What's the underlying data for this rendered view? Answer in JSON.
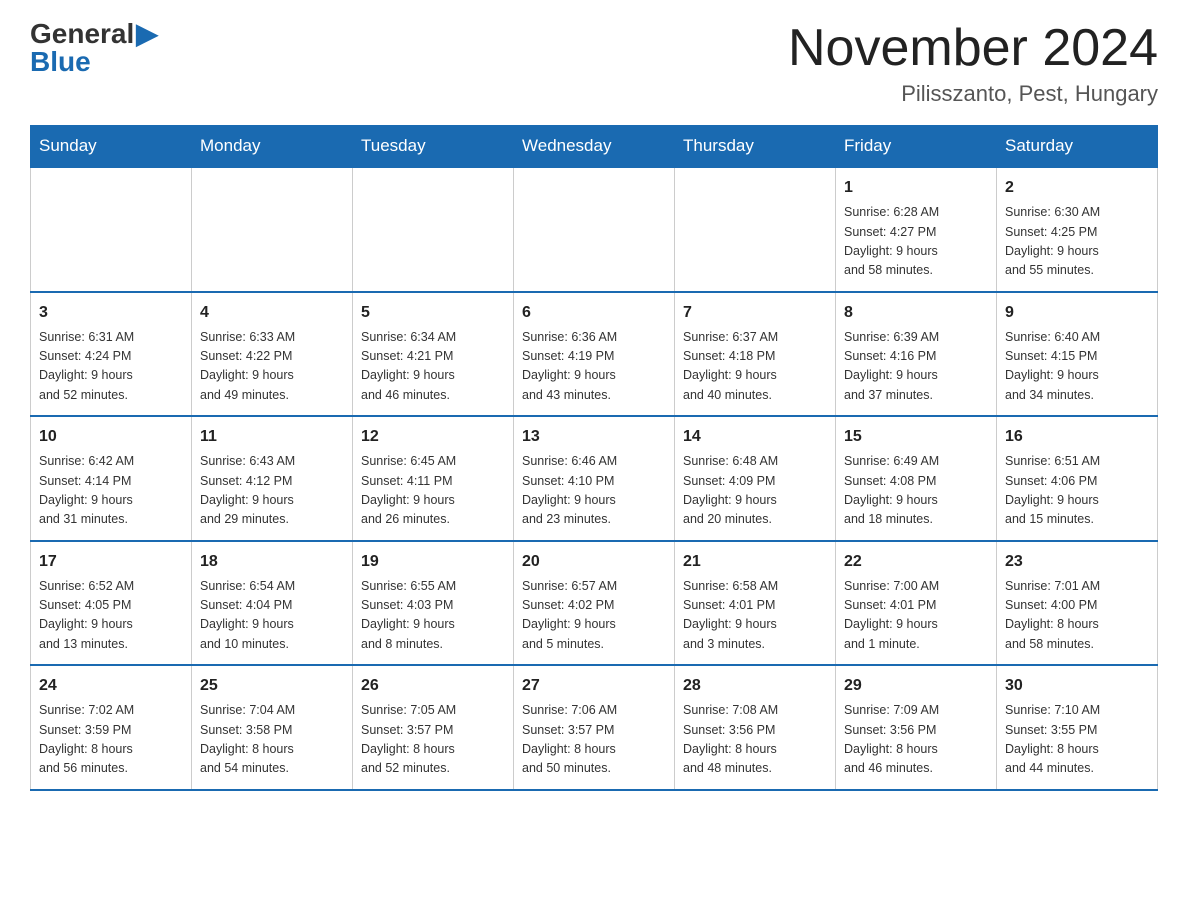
{
  "header": {
    "logo_general": "General",
    "logo_blue": "Blue",
    "month_title": "November 2024",
    "location": "Pilisszanto, Pest, Hungary"
  },
  "weekdays": [
    "Sunday",
    "Monday",
    "Tuesday",
    "Wednesday",
    "Thursday",
    "Friday",
    "Saturday"
  ],
  "weeks": [
    [
      {
        "day": "",
        "info": ""
      },
      {
        "day": "",
        "info": ""
      },
      {
        "day": "",
        "info": ""
      },
      {
        "day": "",
        "info": ""
      },
      {
        "day": "",
        "info": ""
      },
      {
        "day": "1",
        "info": "Sunrise: 6:28 AM\nSunset: 4:27 PM\nDaylight: 9 hours\nand 58 minutes."
      },
      {
        "day": "2",
        "info": "Sunrise: 6:30 AM\nSunset: 4:25 PM\nDaylight: 9 hours\nand 55 minutes."
      }
    ],
    [
      {
        "day": "3",
        "info": "Sunrise: 6:31 AM\nSunset: 4:24 PM\nDaylight: 9 hours\nand 52 minutes."
      },
      {
        "day": "4",
        "info": "Sunrise: 6:33 AM\nSunset: 4:22 PM\nDaylight: 9 hours\nand 49 minutes."
      },
      {
        "day": "5",
        "info": "Sunrise: 6:34 AM\nSunset: 4:21 PM\nDaylight: 9 hours\nand 46 minutes."
      },
      {
        "day": "6",
        "info": "Sunrise: 6:36 AM\nSunset: 4:19 PM\nDaylight: 9 hours\nand 43 minutes."
      },
      {
        "day": "7",
        "info": "Sunrise: 6:37 AM\nSunset: 4:18 PM\nDaylight: 9 hours\nand 40 minutes."
      },
      {
        "day": "8",
        "info": "Sunrise: 6:39 AM\nSunset: 4:16 PM\nDaylight: 9 hours\nand 37 minutes."
      },
      {
        "day": "9",
        "info": "Sunrise: 6:40 AM\nSunset: 4:15 PM\nDaylight: 9 hours\nand 34 minutes."
      }
    ],
    [
      {
        "day": "10",
        "info": "Sunrise: 6:42 AM\nSunset: 4:14 PM\nDaylight: 9 hours\nand 31 minutes."
      },
      {
        "day": "11",
        "info": "Sunrise: 6:43 AM\nSunset: 4:12 PM\nDaylight: 9 hours\nand 29 minutes."
      },
      {
        "day": "12",
        "info": "Sunrise: 6:45 AM\nSunset: 4:11 PM\nDaylight: 9 hours\nand 26 minutes."
      },
      {
        "day": "13",
        "info": "Sunrise: 6:46 AM\nSunset: 4:10 PM\nDaylight: 9 hours\nand 23 minutes."
      },
      {
        "day": "14",
        "info": "Sunrise: 6:48 AM\nSunset: 4:09 PM\nDaylight: 9 hours\nand 20 minutes."
      },
      {
        "day": "15",
        "info": "Sunrise: 6:49 AM\nSunset: 4:08 PM\nDaylight: 9 hours\nand 18 minutes."
      },
      {
        "day": "16",
        "info": "Sunrise: 6:51 AM\nSunset: 4:06 PM\nDaylight: 9 hours\nand 15 minutes."
      }
    ],
    [
      {
        "day": "17",
        "info": "Sunrise: 6:52 AM\nSunset: 4:05 PM\nDaylight: 9 hours\nand 13 minutes."
      },
      {
        "day": "18",
        "info": "Sunrise: 6:54 AM\nSunset: 4:04 PM\nDaylight: 9 hours\nand 10 minutes."
      },
      {
        "day": "19",
        "info": "Sunrise: 6:55 AM\nSunset: 4:03 PM\nDaylight: 9 hours\nand 8 minutes."
      },
      {
        "day": "20",
        "info": "Sunrise: 6:57 AM\nSunset: 4:02 PM\nDaylight: 9 hours\nand 5 minutes."
      },
      {
        "day": "21",
        "info": "Sunrise: 6:58 AM\nSunset: 4:01 PM\nDaylight: 9 hours\nand 3 minutes."
      },
      {
        "day": "22",
        "info": "Sunrise: 7:00 AM\nSunset: 4:01 PM\nDaylight: 9 hours\nand 1 minute."
      },
      {
        "day": "23",
        "info": "Sunrise: 7:01 AM\nSunset: 4:00 PM\nDaylight: 8 hours\nand 58 minutes."
      }
    ],
    [
      {
        "day": "24",
        "info": "Sunrise: 7:02 AM\nSunset: 3:59 PM\nDaylight: 8 hours\nand 56 minutes."
      },
      {
        "day": "25",
        "info": "Sunrise: 7:04 AM\nSunset: 3:58 PM\nDaylight: 8 hours\nand 54 minutes."
      },
      {
        "day": "26",
        "info": "Sunrise: 7:05 AM\nSunset: 3:57 PM\nDaylight: 8 hours\nand 52 minutes."
      },
      {
        "day": "27",
        "info": "Sunrise: 7:06 AM\nSunset: 3:57 PM\nDaylight: 8 hours\nand 50 minutes."
      },
      {
        "day": "28",
        "info": "Sunrise: 7:08 AM\nSunset: 3:56 PM\nDaylight: 8 hours\nand 48 minutes."
      },
      {
        "day": "29",
        "info": "Sunrise: 7:09 AM\nSunset: 3:56 PM\nDaylight: 8 hours\nand 46 minutes."
      },
      {
        "day": "30",
        "info": "Sunrise: 7:10 AM\nSunset: 3:55 PM\nDaylight: 8 hours\nand 44 minutes."
      }
    ]
  ]
}
